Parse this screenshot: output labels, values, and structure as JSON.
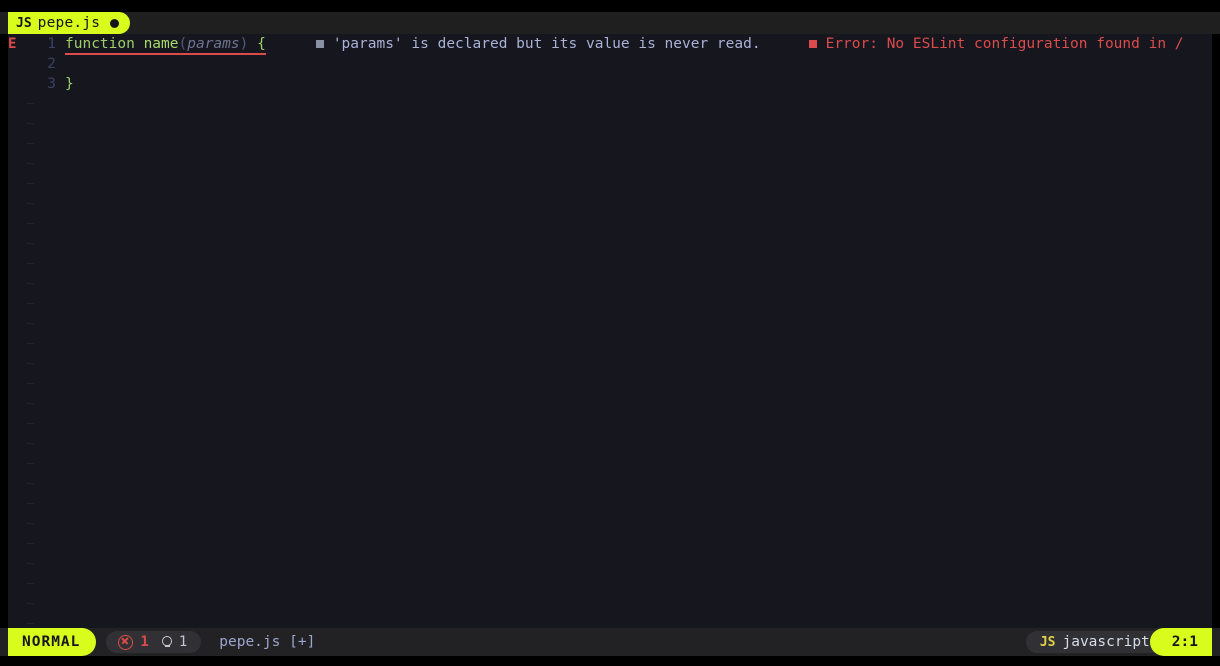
{
  "tab": {
    "icon_label": "JS",
    "icon_name": "javascript-file-icon",
    "filename": "pepe.js",
    "modified_indicator": "modified-dot",
    "background_color": "#d8fc1c",
    "text_color": "#15161a"
  },
  "editor": {
    "sign_column": {
      "line1": "E"
    },
    "lines": [
      {
        "number": "1",
        "tokens": [
          {
            "text": "function",
            "kind": "kw"
          },
          {
            "text": " ",
            "kind": "plain"
          },
          {
            "text": "name",
            "kind": "fn"
          },
          {
            "text": "(",
            "kind": "punct"
          },
          {
            "text": "params",
            "kind": "param"
          },
          {
            "text": ")",
            "kind": "punct"
          },
          {
            "text": " ",
            "kind": "plain"
          },
          {
            "text": "{",
            "kind": "brace"
          }
        ],
        "has_error_underline": true
      },
      {
        "number": "2",
        "tokens": [],
        "has_error_underline": false
      },
      {
        "number": "3",
        "tokens": [
          {
            "text": "}",
            "kind": "brace"
          }
        ],
        "has_error_underline": false
      }
    ],
    "filler_char": "~",
    "diagnostics": [
      {
        "severity": "hint",
        "bullet": "square-bullet-icon",
        "message": "'params' is declared but its value is never read.",
        "color": "#a9b1d6"
      },
      {
        "severity": "error",
        "bullet": "square-bullet-icon",
        "message": "Error: No ESLint configuration found in /",
        "color": "#db4b4b"
      }
    ],
    "background_color": "#16161e"
  },
  "statusline": {
    "mode": "NORMAL",
    "diagnostics": {
      "error_icon": "error-circle-x-icon",
      "error_count": "1",
      "hint_icon": "lightbulb-icon",
      "hint_count": "1"
    },
    "file": "pepe.js [+]",
    "filetype": {
      "icon_label": "JS",
      "name": "javascript"
    },
    "position": "2:1",
    "accent_color": "#d8fc1c",
    "background_color": "#222224"
  }
}
